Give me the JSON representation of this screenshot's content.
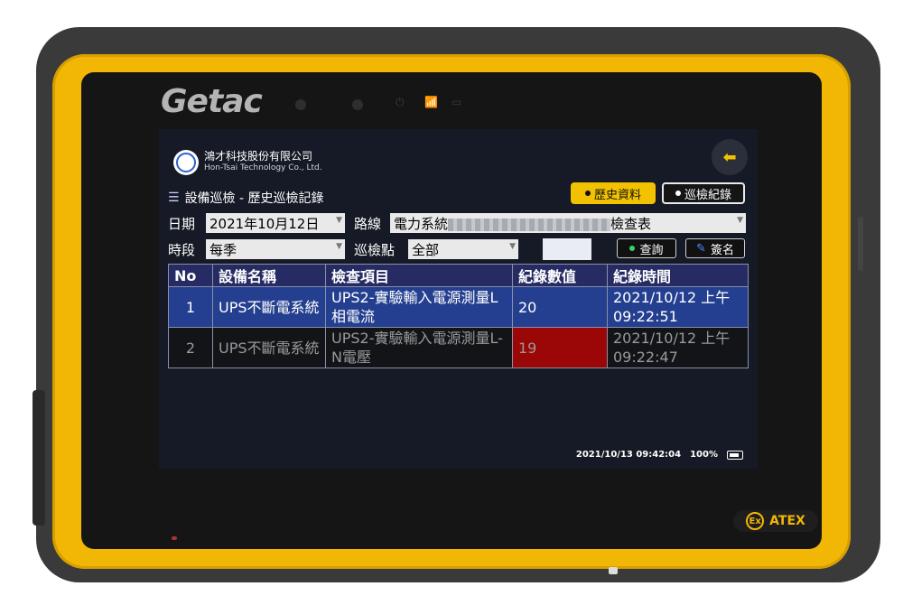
{
  "device": {
    "brand": "Getac",
    "badge": "ATEX",
    "badge_symbol": "Ex",
    "colors": {
      "frame": "#f2b705",
      "bezel": "#151515"
    }
  },
  "app": {
    "company_zh": "鴻才科技股份有限公司",
    "company_en": "Hon-Tsai Technology Co., Ltd.",
    "page_title": "設備巡檢 - 歷史巡檢記錄",
    "title_icon": "search-list-icon",
    "back_icon": "arrow-left-icon",
    "buttons": {
      "history": "歷史資料",
      "patrol_record": "巡檢紀錄",
      "query": "查詢",
      "sign": "簽名"
    },
    "filters": {
      "date_label": "日期",
      "date_value": "2021年10月12日",
      "route_label": "路線",
      "route_value_prefix": "電力系統",
      "route_value_suffix": "檢查表",
      "period_label": "時段",
      "period_value": "每季",
      "point_label": "巡檢點",
      "point_value": "全部"
    },
    "table": {
      "headers": [
        "No",
        "設備名稱",
        "檢查項目",
        "紀錄數值",
        "紀錄時間"
      ],
      "rows": [
        {
          "no": "1",
          "device_name": "UPS不斷電系統",
          "item": "UPS2-實驗輸入電源測量L相電流",
          "value": "20",
          "time": "2021/10/12 上午 09:22:51"
        },
        {
          "no": "2",
          "device_name": "UPS不斷電系統",
          "item": "UPS2-實驗輸入電源測量L-N電壓",
          "value": "19",
          "time": "2021/10/12 上午 09:22:47"
        }
      ]
    },
    "status_bar": {
      "datetime": "2021/10/13  09:42:04",
      "battery": "100%"
    },
    "colors": {
      "accent": "#f2c200",
      "header": "#262c63",
      "selected_row": "#243f8f",
      "alert_cell": "#9b0707"
    }
  }
}
